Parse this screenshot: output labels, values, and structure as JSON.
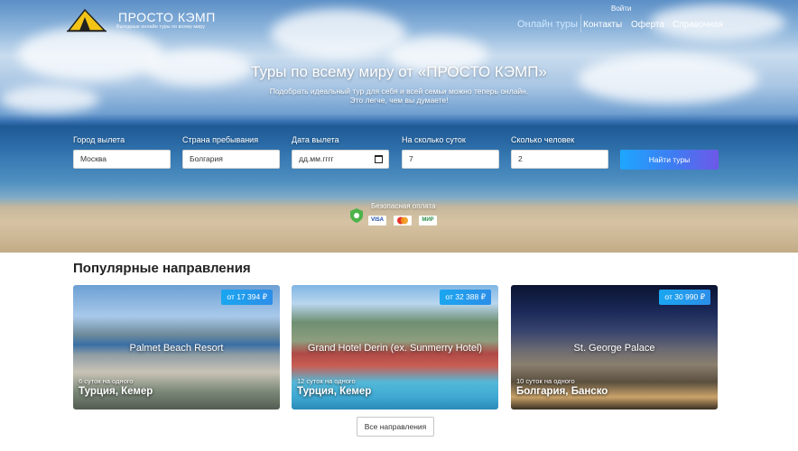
{
  "brand": {
    "name": "ПРОСТО КЭМП",
    "tagline": "Выгодные онлайн туры по всему миру"
  },
  "header": {
    "login_label": "Войти",
    "nav": [
      {
        "label": "Онлайн туры",
        "active": true
      },
      {
        "label": "Контакты",
        "active": false
      },
      {
        "label": "Оферта",
        "active": false
      },
      {
        "label": "Справочная",
        "active": false
      }
    ]
  },
  "hero": {
    "title": "Туры по всему миру от «ПРОСТО КЭМП»",
    "subtitle_line1": "Подобрать идеальный тур для себя и всей семьи можно теперь онлайн.",
    "subtitle_line2": "Это легче, чем вы думаете!"
  },
  "search": {
    "fields": [
      {
        "label": "Город вылета",
        "value": "Москва"
      },
      {
        "label": "Страна пребывания",
        "value": "Болгария"
      },
      {
        "label": "Дата вылета",
        "value": "дд.мм.гггг"
      },
      {
        "label": "На сколько суток",
        "value": "7"
      },
      {
        "label": "Сколько человек",
        "value": "2"
      }
    ],
    "submit_label": "Найти туры"
  },
  "payment": {
    "label": "Безопасная оплата",
    "methods": [
      "VISA",
      "MasterCard",
      "МИР"
    ],
    "colors": {
      "visa": "#1a4aa8",
      "mastercard": "#f29a1c",
      "mir": "#2f8f4e",
      "shield": "#4cb34a"
    }
  },
  "popular": {
    "title": "Популярные направления",
    "cards": [
      {
        "price": "от 17 394 ₽",
        "hotel": "Palmet Beach Resort",
        "nights": "6 суток на одного",
        "place": "Турция, Кемер"
      },
      {
        "price": "от 32 388 ₽",
        "hotel": "Grand Hotel Derin (ex. Sunmerry Hotel)",
        "nights": "12 суток на одного",
        "place": "Турция, Кемер"
      },
      {
        "price": "от 30 990 ₽",
        "hotel": "St. George Palace",
        "nights": "10 суток на одного",
        "place": "Болгария, Банско"
      }
    ],
    "all_label": "Все направления"
  },
  "colors": {
    "accent": "#1ea6ff",
    "button_gradient_end": "#6d58e8",
    "active_nav": "#cde8ff"
  }
}
